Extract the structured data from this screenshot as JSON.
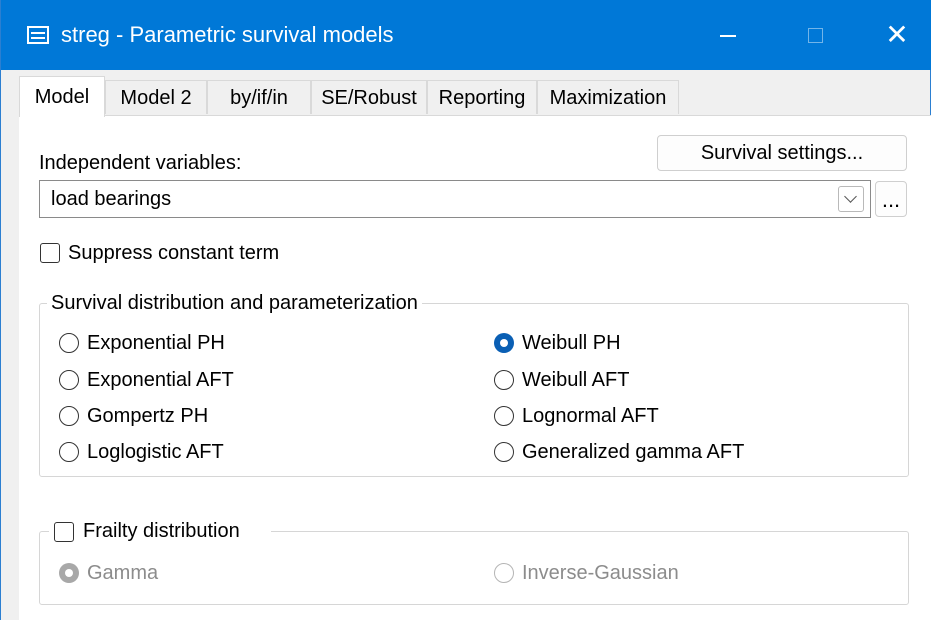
{
  "window": {
    "title": "streg - Parametric survival models",
    "app_icon": "table-icon",
    "controls": {
      "minimize_icon": "minimize-icon",
      "maximize_icon": "maximize-icon",
      "close_glyph": "✕"
    }
  },
  "tabs": [
    {
      "label": "Model",
      "active": true
    },
    {
      "label": "Model 2",
      "active": false
    },
    {
      "label": "by/if/in",
      "active": false
    },
    {
      "label": "SE/Robust",
      "active": false
    },
    {
      "label": "Reporting",
      "active": false
    },
    {
      "label": "Maximization",
      "active": false
    }
  ],
  "model": {
    "survival_settings_label": "Survival settings...",
    "independent_variables_label": "Independent variables:",
    "independent_variables_value": "load bearings",
    "browse_label": "...",
    "suppress_constant_label": "Suppress constant term",
    "suppress_constant_checked": false,
    "distribution_group_label": "Survival distribution and parameterization",
    "distributions": [
      {
        "label": "Exponential PH",
        "selected": false
      },
      {
        "label": "Exponential AFT",
        "selected": false
      },
      {
        "label": "Gompertz PH",
        "selected": false
      },
      {
        "label": "Loglogistic AFT",
        "selected": false
      },
      {
        "label": "Weibull PH",
        "selected": true
      },
      {
        "label": "Weibull AFT",
        "selected": false
      },
      {
        "label": "Lognormal AFT",
        "selected": false
      },
      {
        "label": "Generalized gamma AFT",
        "selected": false
      }
    ],
    "frailty": {
      "label": "Frailty distribution",
      "checked": false,
      "options": [
        {
          "label": "Gamma",
          "selected": true,
          "enabled": false
        },
        {
          "label": "Inverse-Gaussian",
          "selected": false,
          "enabled": false
        }
      ]
    }
  },
  "colors": {
    "titlebar": "#0078d7",
    "radio_selected": "#0a5fb4",
    "disabled_text": "#8c8c8c"
  }
}
